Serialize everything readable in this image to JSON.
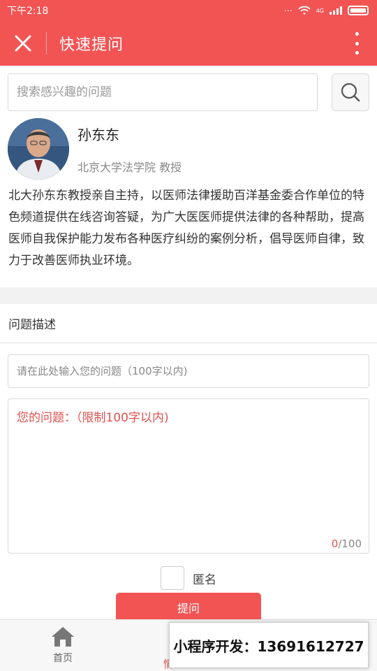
{
  "status_bar": {
    "time": "下午2:18",
    "network": "4G"
  },
  "header": {
    "close_glyph": "✕",
    "title": "快速提问"
  },
  "search": {
    "placeholder": "搜索感兴趣的问题"
  },
  "profile": {
    "name": "孙东东",
    "title": "北京大学法学院 教授"
  },
  "intro": "北大孙东东教授亲自主持，以医师法律援助百洋基金委合作单位的特色频道提供在线咨询答疑，为广大医医师提供法律的各种帮助，提高医师自我保护能力发布各种医疗纠纷的案例分析，倡导医师自律，致力于改善医师执业环境。",
  "form": {
    "section_title": "问题描述",
    "question_placeholder": "请在此处输入您的问题（100字以内)",
    "detail_placeholder": "您的问题：（限制100字以内)",
    "count_current": "0",
    "count_max": "/100",
    "anonymous_label": "匿名",
    "submit_label": "提问"
  },
  "tabbar": {
    "home_label": "首页",
    "partial_label": "情"
  },
  "promo": "小程序开发：13691612727",
  "colors": {
    "brand": "#f25454",
    "placeholder_red": "#e05050"
  }
}
